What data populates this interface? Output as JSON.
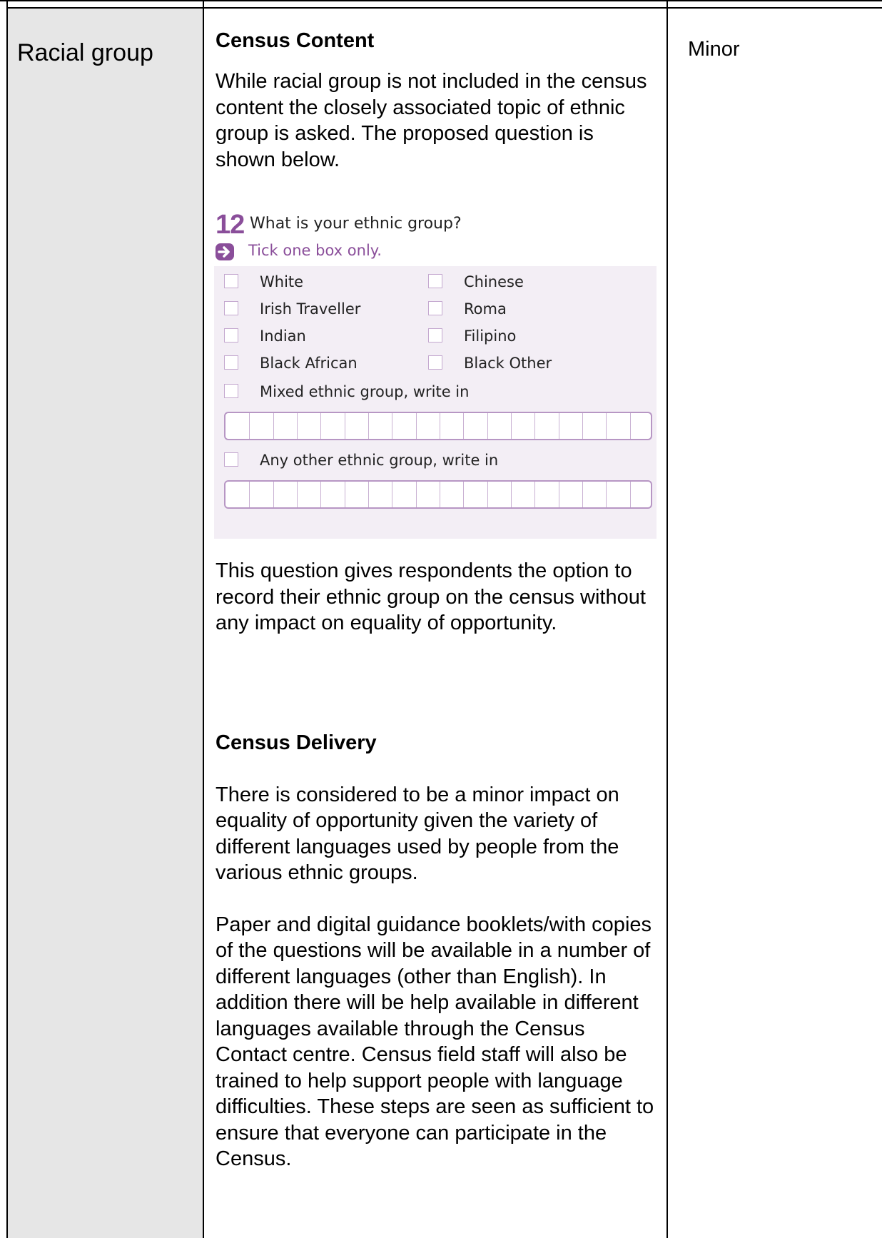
{
  "topic": "Racial group",
  "impact": "Minor",
  "content": {
    "heading": "Census Content",
    "intro": "While racial group is not included in the census content the closely associated topic of ethnic group is asked. The proposed question is shown below.",
    "after": "This question gives respondents the option to record their ethnic group on the census without any impact on equality of opportunity."
  },
  "question": {
    "number": "12",
    "text": "What is your ethnic group?",
    "instruction": "Tick one box only.",
    "options": [
      "White",
      "Chinese",
      "Irish Traveller",
      "Roma",
      "Indian",
      "Filipino",
      "Black African",
      "Black Other",
      "Mixed ethnic group, write in",
      "Any other ethnic group, write in"
    ],
    "accent_color": "#8a4e9a",
    "panel_color": "#f3eef5"
  },
  "delivery": {
    "heading": "Census Delivery",
    "para1": "There is considered to be a minor impact on equality of opportunity given the variety of different languages used by people from the various ethnic groups.",
    "para2": "Paper and digital guidance booklets/with copies of the questions will be available in a number of different languages (other than English). In addition there will be help available in different languages available through the Census Contact centre. Census field staff will also be trained to help support people with language difficulties. These steps are seen as sufficient to ensure that everyone can participate in the Census."
  }
}
